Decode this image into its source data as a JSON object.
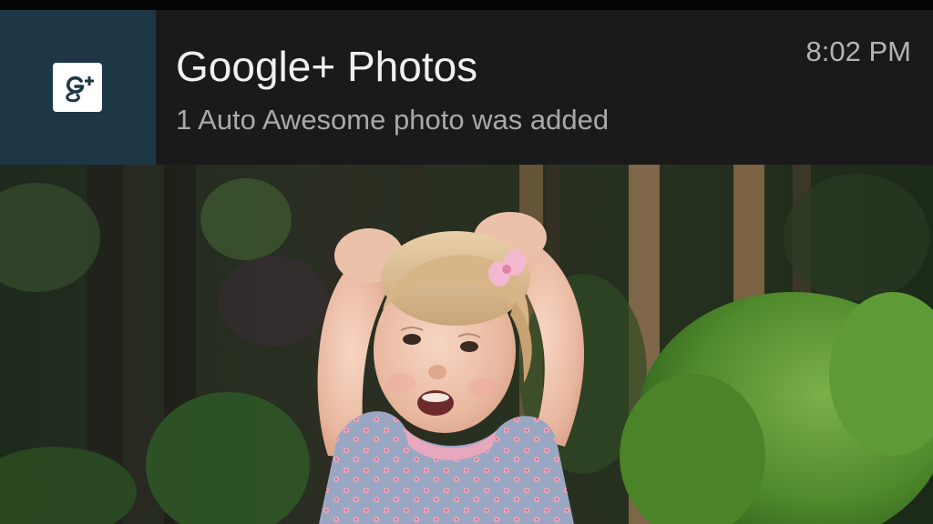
{
  "notification": {
    "app_icon": "google-plus-icon",
    "title": "Google+ Photos",
    "text": "1 Auto Awesome photo was added",
    "time": "8:02 PM"
  },
  "photo": {
    "subject": "toddler-photo"
  },
  "colors": {
    "notification_background": "#1a1a1a",
    "icon_area_background": "#1d3747",
    "title": "#f0f0f0",
    "text": "#a9a9a9",
    "time": "#b4b4b4"
  }
}
